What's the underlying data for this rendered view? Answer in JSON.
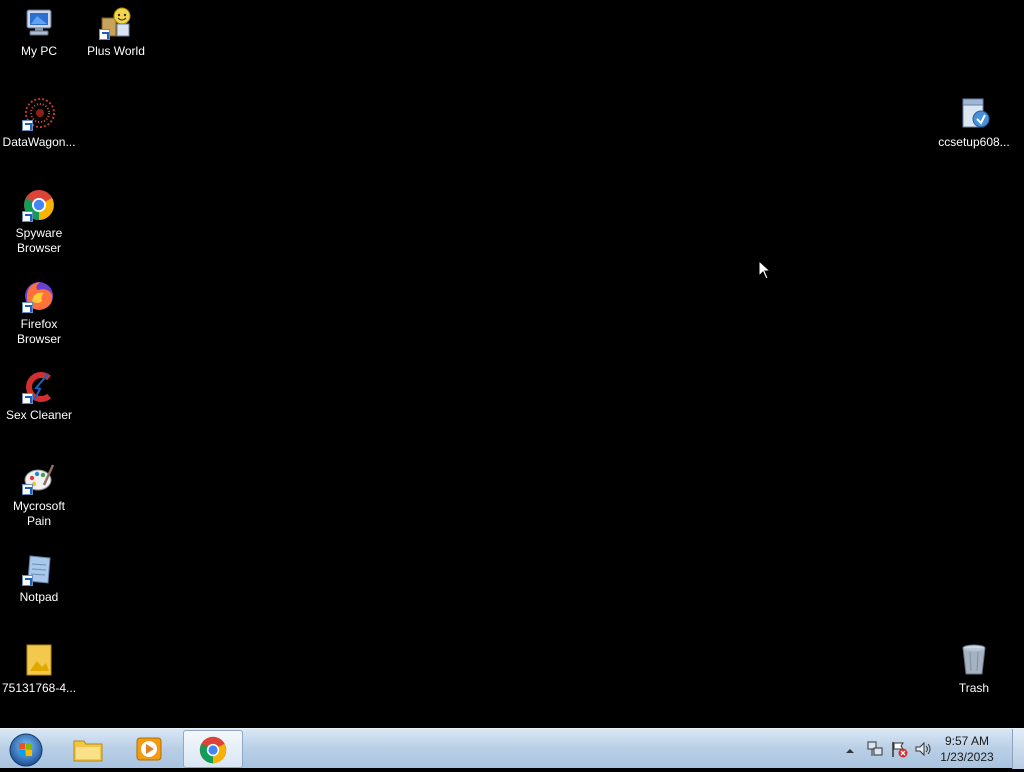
{
  "desktop": {
    "icons": [
      {
        "label": "My PC"
      },
      {
        "label": "Plus World"
      },
      {
        "label": "DataWagon..."
      },
      {
        "label": "Spyware Browser"
      },
      {
        "label": "Firefox Browser"
      },
      {
        "label": "Sex Cleaner"
      },
      {
        "label": "Mycrosoft Pain"
      },
      {
        "label": "Notpad"
      },
      {
        "label": "75131768-4..."
      },
      {
        "label": "ccsetup608..."
      },
      {
        "label": "Trash"
      }
    ]
  },
  "taskbar": {
    "pinned": [
      {
        "icon": "file-explorer-icon"
      },
      {
        "icon": "media-player-icon"
      },
      {
        "icon": "chrome-icon",
        "active": true
      }
    ],
    "clock": {
      "time": "9:57 AM",
      "date": "1/23/2023"
    }
  },
  "colors": {
    "desktop_background": "#000000",
    "taskbar": "#b9cfe6"
  }
}
